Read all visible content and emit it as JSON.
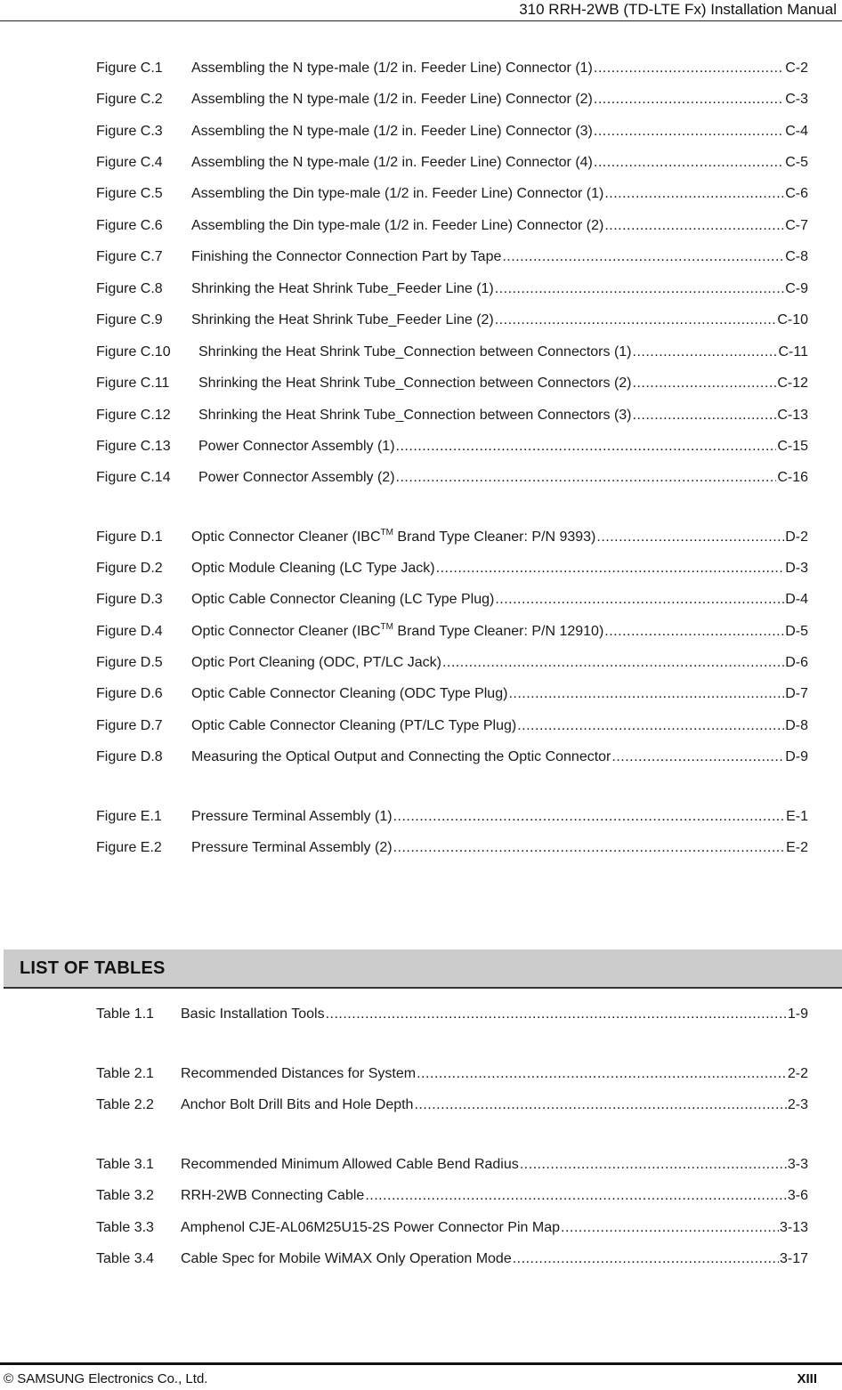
{
  "header": {
    "title": "310 RRH-2WB (TD-LTE Fx) Installation Manual"
  },
  "figures": [
    {
      "label": "Figure C.1",
      "title": "Assembling the N type-male (1/2 in. Feeder Line) Connector (1)",
      "page": "C-2"
    },
    {
      "label": "Figure C.2",
      "title": "Assembling the N type-male (1/2 in. Feeder Line) Connector (2)",
      "page": "C-3"
    },
    {
      "label": "Figure C.3",
      "title": "Assembling the N type-male (1/2 in. Feeder Line) Connector (3)",
      "page": "C-4"
    },
    {
      "label": "Figure C.4",
      "title": "Assembling the N type-male (1/2 in. Feeder Line) Connector (4)",
      "page": "C-5"
    },
    {
      "label": "Figure C.5",
      "title": "Assembling the Din type-male (1/2 in. Feeder Line) Connector (1)",
      "page": "C-6"
    },
    {
      "label": "Figure C.6",
      "title": "Assembling the Din type-male (1/2 in. Feeder Line) Connector (2)",
      "page": "C-7"
    },
    {
      "label": "Figure C.7",
      "title": "Finishing the Connector Connection Part by Tape",
      "page": "C-8"
    },
    {
      "label": "Figure C.8",
      "title": "Shrinking the Heat Shrink Tube_Feeder Line (1)",
      "page": "C-9"
    },
    {
      "label": "Figure C.9",
      "title": "Shrinking the Heat Shrink Tube_Feeder Line (2)",
      "page": "C-10"
    },
    {
      "label": "Figure C.10",
      "title": "Shrinking the Heat Shrink Tube_Connection between Connectors (1)",
      "page": "C-11"
    },
    {
      "label": "Figure C.11",
      "title": "Shrinking the Heat Shrink Tube_Connection between Connectors (2)",
      "page": "C-12"
    },
    {
      "label": "Figure C.12",
      "title": "Shrinking the Heat Shrink Tube_Connection between Connectors (3)",
      "page": "C-13"
    },
    {
      "label": "Figure C.13",
      "title": "Power Connector Assembly (1)",
      "page": "C-15"
    },
    {
      "label": "Figure C.14",
      "title": "Power Connector Assembly (2)",
      "page": "C-16"
    },
    {
      "label": "Figure D.1",
      "title_pre": "Optic Connector Cleaner (IBC",
      "title_sup": "TM",
      "title_post": " Brand Type Cleaner: P/N 9393)",
      "page": "D-2"
    },
    {
      "label": "Figure D.2",
      "title": "Optic Module Cleaning (LC Type Jack)",
      "page": "D-3"
    },
    {
      "label": "Figure D.3",
      "title": "Optic Cable Connector Cleaning (LC Type Plug)",
      "page": "D-4"
    },
    {
      "label": "Figure D.4",
      "title_pre": "Optic Connector Cleaner (IBC",
      "title_sup": "TM",
      "title_post": " Brand Type Cleaner: P/N 12910)",
      "page": "D-5"
    },
    {
      "label": "Figure D.5",
      "title": "Optic Port Cleaning (ODC, PT/LC Jack)",
      "page": "D-6"
    },
    {
      "label": "Figure D.6",
      "title": "Optic Cable Connector Cleaning (ODC Type Plug)",
      "page": "D-7"
    },
    {
      "label": "Figure D.7",
      "title": "Optic Cable Connector Cleaning (PT/LC Type Plug)",
      "page": "D-8"
    },
    {
      "label": "Figure D.8",
      "title": "Measuring the Optical Output and Connecting the Optic Connector",
      "page": "D-9"
    },
    {
      "label": "Figure E.1",
      "title": "Pressure Terminal Assembly (1)",
      "page": "E-1"
    },
    {
      "label": "Figure E.2",
      "title": "Pressure Terminal Assembly (2)",
      "page": "E-2"
    }
  ],
  "tables_section": {
    "title": "LIST OF TABLES"
  },
  "tables": [
    {
      "label": "Table 1.1",
      "title": "Basic Installation Tools",
      "page": "1-9"
    },
    {
      "label": "Table 2.1",
      "title": "Recommended Distances for System",
      "page": "2-2"
    },
    {
      "label": "Table 2.2",
      "title": "Anchor Bolt Drill Bits and Hole Depth",
      "page": "2-3"
    },
    {
      "label": "Table 3.1",
      "title": "Recommended Minimum Allowed Cable Bend Radius",
      "page": "3-3"
    },
    {
      "label": "Table 3.2",
      "title": "RRH-2WB Connecting Cable",
      "page": "3-6"
    },
    {
      "label": "Table 3.3",
      "title": "Amphenol CJE-AL06M25U15-2S Power Connector Pin Map",
      "page": "3-13"
    },
    {
      "label": "Table 3.4",
      "title": "Cable Spec for Mobile WiMAX Only Operation Mode",
      "page": "3-17"
    }
  ],
  "footer": {
    "copyright": "© SAMSUNG Electronics Co., Ltd.",
    "page_number": "XIII"
  }
}
